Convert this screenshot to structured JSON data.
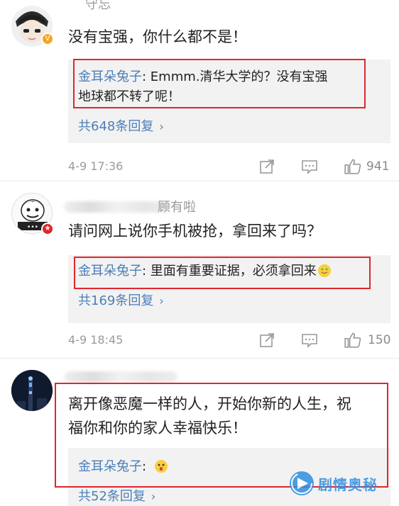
{
  "comments": [
    {
      "username": "守忘",
      "text": "没有宝强，你什么都不是！",
      "reply_author": "金耳朵兔子",
      "reply_line1": ": Emmm.清华大学的？没有宝强",
      "reply_line2": "地球都不转了呢！",
      "more_replies": "共648条回复",
      "time": "4-9 17:36",
      "likes": "941"
    },
    {
      "username": "顾有啦",
      "text": "请问网上说你手机被抢，拿回来了吗？",
      "reply_author": "金耳朵兔子",
      "reply_line1": ": 里面有重要证据，必须拿回来",
      "more_replies": "共169条回复",
      "time": "4-9 18:45",
      "likes": "150"
    },
    {
      "text_line1": "离开像恶魔一样的人，开始你新的人生，祝",
      "text_line2": "福你和你的家人幸福快乐！",
      "reply_author": "金耳朵兔子",
      "reply_line1": ":",
      "more_replies": "共52条回复"
    }
  ],
  "icons": {
    "chevron": "›",
    "badge_verified": "V",
    "badge_star": "★"
  },
  "watermark": "剧情奥秘",
  "colors": {
    "link": "#4a7fb8",
    "highlight_box": "#e0262d",
    "reply_bg": "#f2f2f2",
    "meta": "#9a9a9a"
  }
}
